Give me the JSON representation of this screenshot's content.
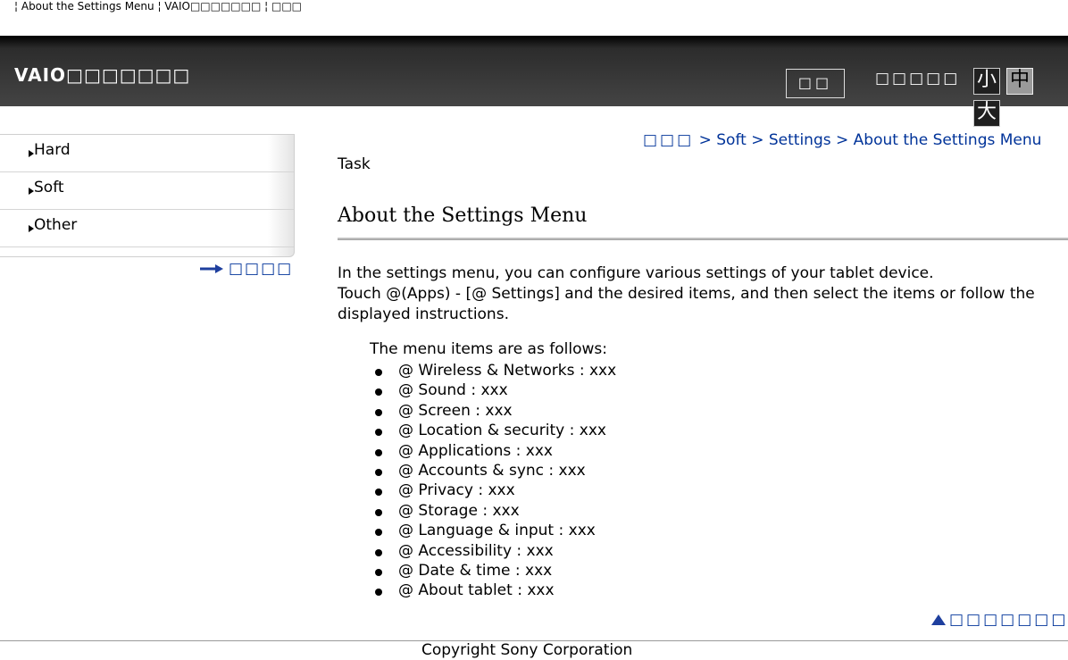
{
  "topline": "¦ About the Settings Menu ¦ VAIO□□□□□□□ ¦ □□□",
  "header": {
    "title": "VAIO□□□□□□□",
    "search_label": "□□",
    "font_size_label": "□□□□□",
    "font_small": "小",
    "font_medium": "中",
    "font_large": "大"
  },
  "sidebar": {
    "items": [
      {
        "label": "Hard"
      },
      {
        "label": "Soft"
      },
      {
        "label": "Other"
      }
    ],
    "sitemap_label": "□□□□"
  },
  "breadcrumb": {
    "home": "□□□",
    "sep": ">",
    "items": [
      "Soft",
      "Settings",
      "About the Settings Menu"
    ]
  },
  "main": {
    "task_label": "Task",
    "title": "About the Settings Menu",
    "para1": "In the settings menu, you can configure various settings of your tablet device.",
    "para2": "Touch @(Apps) - [@ Settings] and the desired items, and then select the items or follow the displayed instructions.",
    "menu_intro": "The menu items are as follows:",
    "menu_items": [
      "@ Wireless & Networks : xxx",
      "@ Sound : xxx",
      "@ Screen : xxx",
      "@ Location & security : xxx",
      "@ Applications : xxx",
      "@ Accounts & sync : xxx",
      "@ Privacy : xxx",
      "@ Storage : xxx",
      "@ Language & input : xxx",
      "@ Accessibility : xxx",
      "@ Date & time : xxx",
      "@ About tablet : xxx"
    ]
  },
  "back_to_top": "□□□□□□□",
  "footer": {
    "copyright": "Copyright Sony Corporation"
  },
  "colors": {
    "link": "#003399",
    "header_bg": "#2c2c2c"
  }
}
